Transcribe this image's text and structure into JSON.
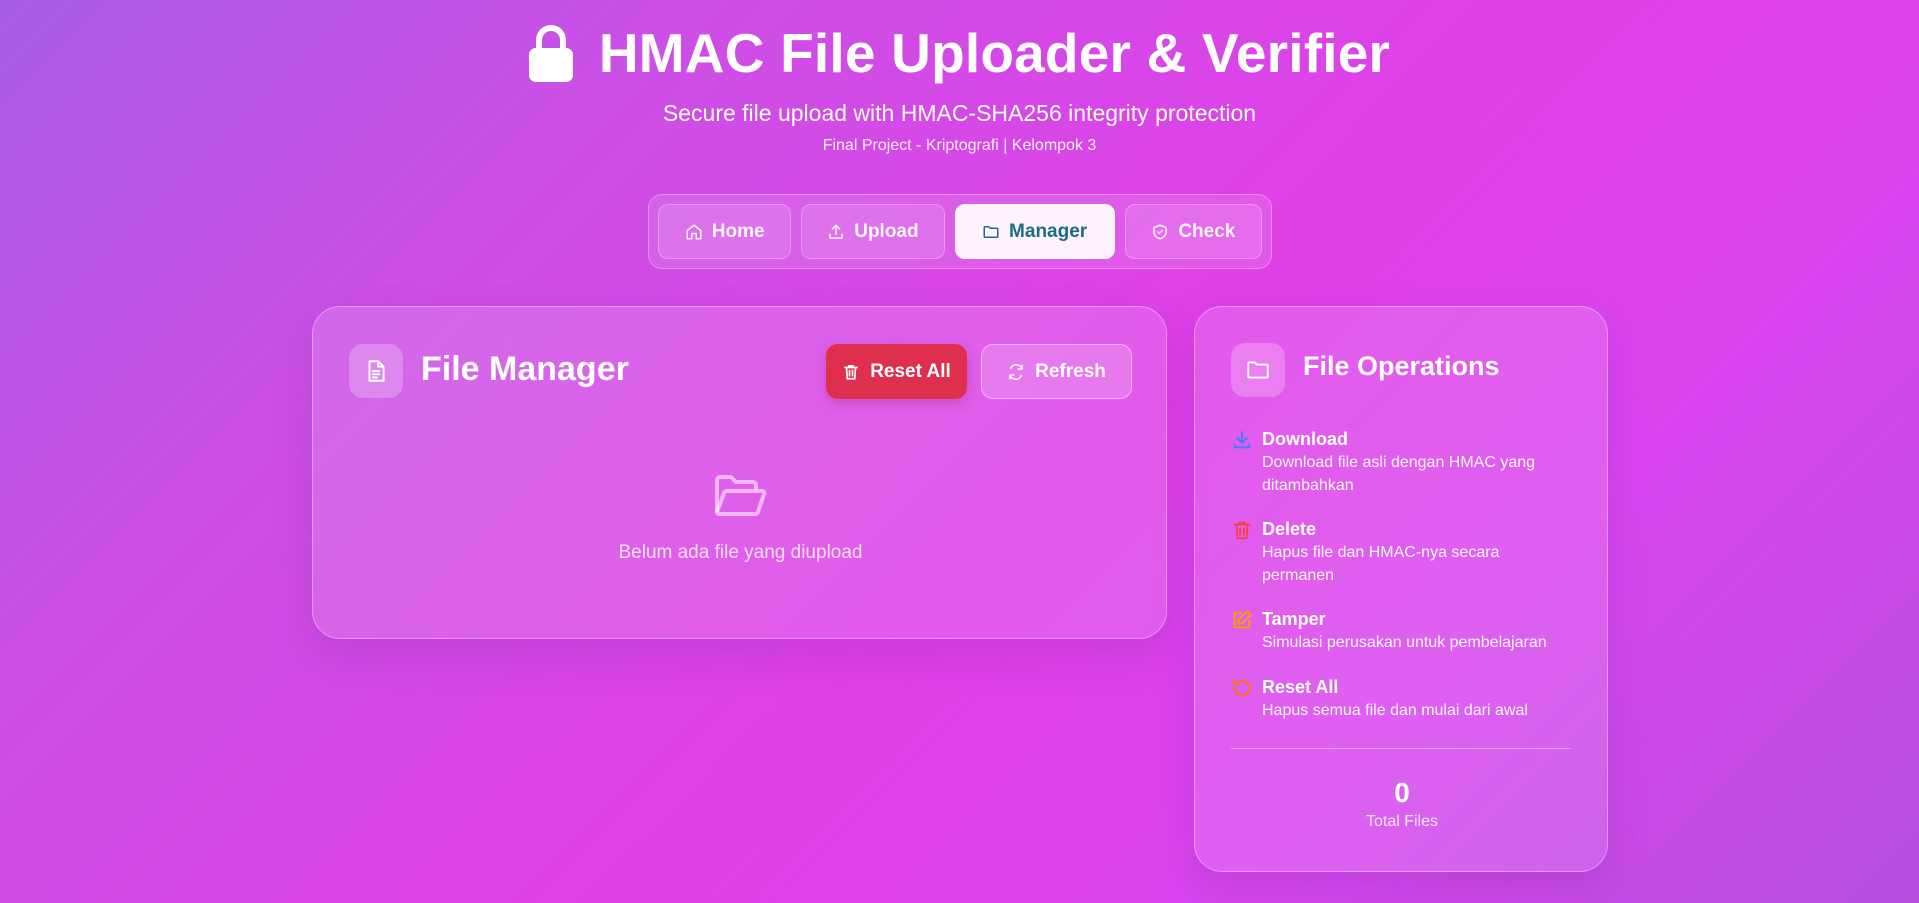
{
  "header": {
    "title": "HMAC File Uploader & Verifier",
    "subtitle": "Secure file upload with HMAC-SHA256 integrity protection",
    "course": "Final Project - Kriptografi | Kelompok 3",
    "icon": "lock-icon"
  },
  "nav": {
    "tabs": [
      {
        "label": "Home",
        "icon": "home-icon",
        "active": false
      },
      {
        "label": "Upload",
        "icon": "upload-icon",
        "active": false
      },
      {
        "label": "Manager",
        "icon": "folder-icon",
        "active": true
      },
      {
        "label": "Check",
        "icon": "shield-check-icon",
        "active": false
      }
    ]
  },
  "file_manager": {
    "title": "File Manager",
    "reset_label": "Reset All",
    "refresh_label": "Refresh",
    "empty_text": "Belum ada file yang diupload"
  },
  "operations": {
    "title": "File Operations",
    "items": [
      {
        "title": "Download",
        "desc": "Download file asli dengan HMAC yang ditambahkan",
        "icon": "download-icon",
        "color": "#3b82f6"
      },
      {
        "title": "Delete",
        "desc": "Hapus file dan HMAC-nya secara permanen",
        "icon": "trash-icon",
        "color": "#ef4444"
      },
      {
        "title": "Tamper",
        "desc": "Simulasi perusakan untuk pembelajaran",
        "icon": "edit-icon",
        "color": "#f59e0b"
      },
      {
        "title": "Reset All",
        "desc": "Hapus semua file dan mulai dari awal",
        "icon": "reset-icon",
        "color": "#f97316"
      }
    ],
    "total_count": "0",
    "total_label": "Total Files"
  },
  "colors": {
    "accent_active_text": "#1e6b86",
    "danger": "#de2f4f"
  }
}
